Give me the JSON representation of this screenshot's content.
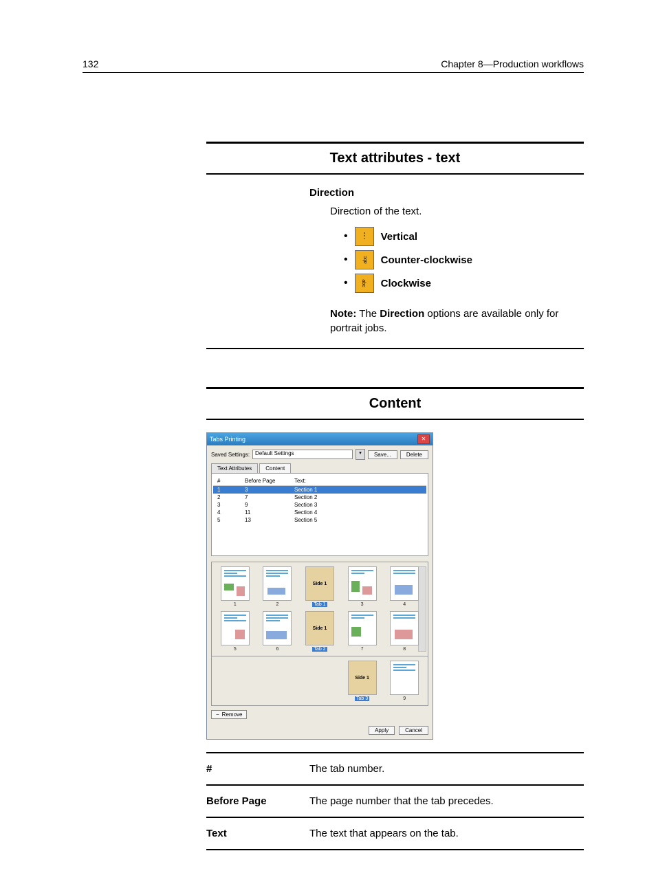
{
  "header": {
    "page_number": "132",
    "chapter": "Chapter 8—Production workflows"
  },
  "section1": {
    "title": "Text attributes - text",
    "direction_heading": "Direction",
    "direction_desc": "Direction of the text.",
    "options": {
      "vertical": "Vertical",
      "ccw": "Counter-clockwise",
      "cw": "Clockwise"
    },
    "note_prefix": "Note:",
    "note_mid1": " The ",
    "note_bold": "Direction",
    "note_mid2": " options are available only for portrait jobs."
  },
  "section2": {
    "title": "Content"
  },
  "dialog": {
    "title": "Tabs Printing",
    "saved_settings_label": "Saved Settings:",
    "saved_settings_value": "Default Settings",
    "save_btn": "Save...",
    "delete_btn": "Delete",
    "tabs": {
      "text_attributes": "Text Attributes",
      "content": "Content"
    },
    "table": {
      "col_num": "#",
      "col_before": "Before Page",
      "col_text": "Text:",
      "rows": [
        {
          "num": "1",
          "before": "3",
          "text": "Section 1",
          "selected": true
        },
        {
          "num": "2",
          "before": "7",
          "text": "Section 2",
          "selected": false
        },
        {
          "num": "3",
          "before": "9",
          "text": "Section 3",
          "selected": false
        },
        {
          "num": "4",
          "before": "11",
          "text": "Section 4",
          "selected": false
        },
        {
          "num": "5",
          "before": "13",
          "text": "Section 5",
          "selected": false
        }
      ]
    },
    "preview": {
      "side1": "Side 1",
      "tab1": "Tab 1",
      "tab2": "Tab 2",
      "tab3": "Tab 3",
      "p1": "1",
      "p2": "2",
      "p3": "3",
      "p4": "4",
      "p5": "5",
      "p6": "6",
      "p7": "7",
      "p8": "8",
      "p9": "9"
    },
    "remove_btn": "Remove",
    "apply_btn": "Apply",
    "cancel_btn": "Cancel"
  },
  "definitions": [
    {
      "term": "#",
      "desc": "The tab number."
    },
    {
      "term": "Before Page",
      "desc": "The page number that the tab precedes."
    },
    {
      "term": "Text",
      "desc": "The text that appears on the tab."
    }
  ]
}
